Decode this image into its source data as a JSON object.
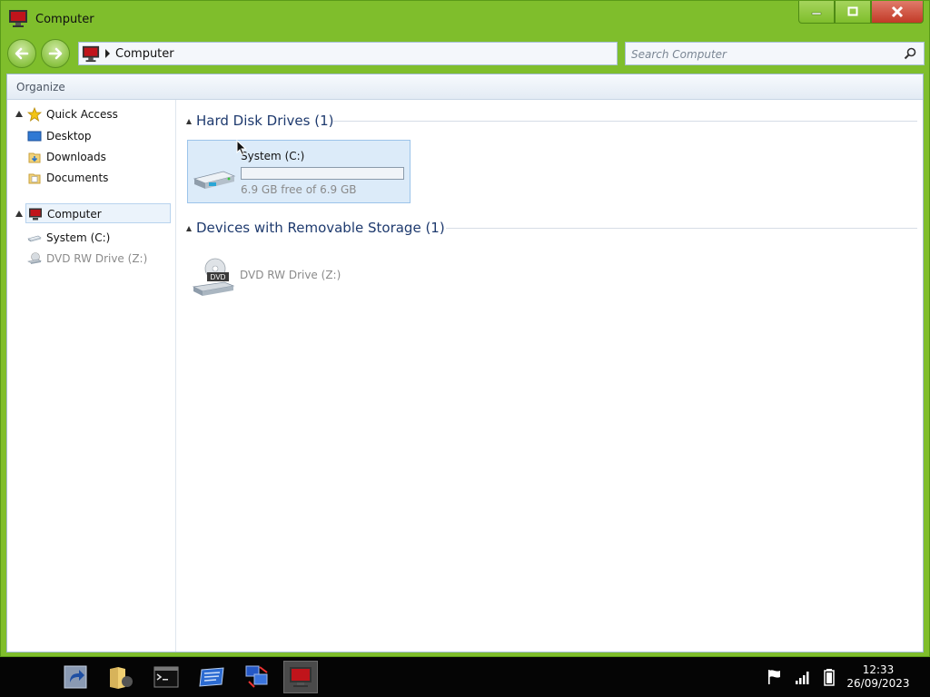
{
  "window": {
    "title": "Computer",
    "icon": "computer-icon",
    "controls": {
      "minimize": "minimize-icon",
      "maximize": "maximize-icon",
      "close": "close-icon"
    }
  },
  "nav": {
    "back": "back-arrow-icon",
    "forward": "forward-arrow-icon",
    "address": {
      "icon": "computer-icon",
      "path": "Computer"
    },
    "search": {
      "placeholder": "Search Computer",
      "icon": "search-icon"
    }
  },
  "commandbar": {
    "organize": "Organize"
  },
  "sidebar": {
    "quick_access": {
      "label": "Quick Access",
      "icon": "star-icon"
    },
    "quick_items": [
      {
        "label": "Desktop",
        "icon": "desktop-icon"
      },
      {
        "label": "Downloads",
        "icon": "downloads-folder-icon"
      },
      {
        "label": "Documents",
        "icon": "documents-folder-icon"
      }
    ],
    "computer": {
      "label": "Computer",
      "icon": "computer-icon"
    },
    "drives": [
      {
        "label": "System (C:)",
        "icon": "hard-disk-icon"
      },
      {
        "label": "DVD RW Drive (Z:)",
        "icon": "dvd-drive-icon"
      }
    ]
  },
  "content": {
    "groups": [
      {
        "title": "Hard Disk Drives (1)",
        "items": [
          {
            "name": "System (C:)",
            "free_text": "6.9 GB free of 6.9 GB",
            "used_fraction": 0.0,
            "icon": "hard-disk-icon"
          }
        ]
      },
      {
        "title": "Devices with Removable Storage (1)",
        "items": [
          {
            "name": "DVD RW Drive (Z:)",
            "icon": "dvd-drive-icon",
            "badge": "DVD"
          }
        ]
      }
    ]
  },
  "taskbar": {
    "items": [
      "shortcut-icon",
      "file-manager-icon",
      "terminal-icon",
      "control-panel-icon",
      "network-icon",
      "computer-icon"
    ],
    "active": "computer-icon",
    "tray": [
      "flag-icon",
      "signal-icon",
      "battery-icon"
    ],
    "time": "12:33",
    "date": "26/09/2023"
  },
  "colors": {
    "accent": "#7fbe2c",
    "group_title": "#1e3a6e",
    "selection": "#dcebf9"
  }
}
